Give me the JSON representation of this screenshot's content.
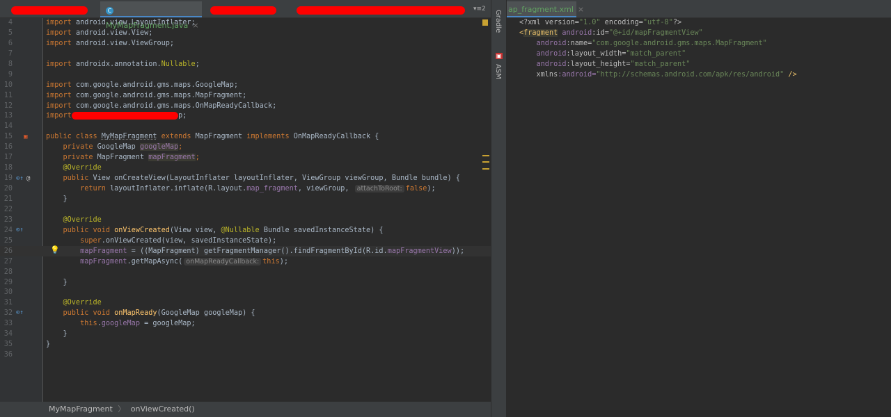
{
  "tabs": {
    "active_label": "MyMapFragment.java",
    "xml_label": "ap_fragment.xml",
    "more": "▾≡2"
  },
  "side": {
    "gradle": "Gradle",
    "asm": "ASM"
  },
  "breadcrumb": {
    "class": "MyMapFragment",
    "method": "onViewCreated()",
    "sep": "〉"
  },
  "java_lines": [
    {
      "n": "4",
      "t": [
        [
          "import",
          "kw"
        ],
        [
          " android.view.LayoutInflater;",
          ""
        ]
      ]
    },
    {
      "n": "5",
      "t": [
        [
          "import",
          "kw"
        ],
        [
          " android.view.View;",
          ""
        ]
      ]
    },
    {
      "n": "6",
      "t": [
        [
          "import",
          "kw"
        ],
        [
          " android.view.ViewGroup;",
          ""
        ]
      ]
    },
    {
      "n": "7",
      "t": []
    },
    {
      "n": "8",
      "t": [
        [
          "import",
          "kw"
        ],
        [
          " androidx.annotation.",
          ""
        ],
        [
          "Nullable",
          "ann"
        ],
        [
          ";",
          ""
        ]
      ]
    },
    {
      "n": "9",
      "t": []
    },
    {
      "n": "10",
      "t": [
        [
          "import",
          "kw"
        ],
        [
          " com.google.android.gms.maps.GoogleMap;",
          ""
        ]
      ]
    },
    {
      "n": "11",
      "t": [
        [
          "import",
          "kw"
        ],
        [
          " com.google.android.gms.maps.MapFragment;",
          ""
        ]
      ]
    },
    {
      "n": "12",
      "t": [
        [
          "import",
          "kw"
        ],
        [
          " com.google.android.gms.maps.OnMapReadyCallback;",
          ""
        ]
      ]
    },
    {
      "n": "13",
      "t": [
        [
          "import",
          "kw"
        ],
        [
          "                         ",
          "redact"
        ],
        [
          "p;",
          ""
        ]
      ]
    },
    {
      "n": "14",
      "t": []
    },
    {
      "n": "15",
      "t": [
        [
          "public class ",
          "kw"
        ],
        [
          "MyMapFragment",
          "cls"
        ],
        [
          " extends ",
          "kw"
        ],
        [
          "MapFragment",
          ""
        ],
        [
          " implements ",
          "kw"
        ],
        [
          "OnMapReadyCallback {",
          ""
        ]
      ]
    },
    {
      "n": "16",
      "t": [
        [
          "    private ",
          "kw"
        ],
        [
          "GoogleMap ",
          ""
        ],
        [
          "googleMap",
          "fldh"
        ],
        [
          ";",
          "kw"
        ]
      ]
    },
    {
      "n": "17",
      "t": [
        [
          "    private ",
          "kw"
        ],
        [
          "MapFragment ",
          ""
        ],
        [
          "mapFragment",
          "fldh"
        ],
        [
          ";",
          "kw"
        ]
      ]
    },
    {
      "n": "18",
      "t": [
        [
          "    @Override",
          "ann"
        ]
      ]
    },
    {
      "n": "19",
      "t": [
        [
          "    public ",
          "kw"
        ],
        [
          "View ",
          ""
        ],
        [
          "onCreateView",
          ""
        ],
        [
          "(LayoutInflater layoutInflater, ViewGroup viewGroup, Bundle bundle) {",
          ""
        ]
      ]
    },
    {
      "n": "20",
      "t": [
        [
          "        return ",
          "kw"
        ],
        [
          "layoutInflater.inflate(R.layout.",
          ""
        ],
        [
          "map_fragment",
          "fld"
        ],
        [
          ", viewGroup, ",
          ""
        ],
        [
          "attachToRoot:",
          "hint"
        ],
        [
          "false",
          "kw"
        ],
        [
          ");",
          ""
        ]
      ]
    },
    {
      "n": "21",
      "t": [
        [
          "    }",
          ""
        ]
      ]
    },
    {
      "n": "22",
      "t": []
    },
    {
      "n": "23",
      "t": [
        [
          "    @Override",
          "ann"
        ]
      ]
    },
    {
      "n": "24",
      "t": [
        [
          "    public void ",
          "kw"
        ],
        [
          "onViewCreated",
          "mth"
        ],
        [
          "(View view, ",
          ""
        ],
        [
          "@Nullable",
          "ann"
        ],
        [
          " Bundle savedInstanceState) {",
          ""
        ]
      ]
    },
    {
      "n": "25",
      "t": [
        [
          "        super",
          "kw"
        ],
        [
          ".onViewCreated(view, savedInstanceState);",
          ""
        ]
      ]
    },
    {
      "n": "26",
      "t": [
        [
          "        mapFragment",
          "fld"
        ],
        [
          " = ((MapFragment) getFragmentManager().findFragmentById(R.id.",
          ""
        ],
        [
          "mapFragmentView",
          "fld"
        ],
        [
          "));",
          ""
        ]
      ]
    },
    {
      "n": "27",
      "t": [
        [
          "        mapFragment",
          "fld"
        ],
        [
          ".getMapAsync(",
          ""
        ],
        [
          "onMapReadyCallback:",
          "hint"
        ],
        [
          "this",
          "kw"
        ],
        [
          ");",
          ""
        ]
      ]
    },
    {
      "n": "28",
      "t": []
    },
    {
      "n": "29",
      "t": [
        [
          "    }",
          ""
        ]
      ]
    },
    {
      "n": "30",
      "t": []
    },
    {
      "n": "31",
      "t": [
        [
          "    @Override",
          "ann"
        ]
      ]
    },
    {
      "n": "32",
      "t": [
        [
          "    public void ",
          "kw"
        ],
        [
          "onMapReady",
          "mth"
        ],
        [
          "(GoogleMap googleMap) {",
          ""
        ]
      ]
    },
    {
      "n": "33",
      "t": [
        [
          "        this",
          "kw"
        ],
        [
          ".",
          ""
        ],
        [
          "googleMap",
          "fld"
        ],
        [
          " = googleMap;",
          ""
        ]
      ]
    },
    {
      "n": "34",
      "t": [
        [
          "    }",
          ""
        ]
      ]
    },
    {
      "n": "35",
      "t": [
        [
          "}",
          ""
        ]
      ]
    },
    {
      "n": "36",
      "t": []
    }
  ],
  "xml_lines": [
    {
      "t": [
        [
          "<?xml version=",
          "xtxt"
        ],
        [
          "\"1.0\"",
          "str"
        ],
        [
          " encoding=",
          "xtxt"
        ],
        [
          "\"utf-8\"",
          "str"
        ],
        [
          "?>",
          "xtxt"
        ]
      ]
    },
    {
      "t": [
        [
          "<",
          "tag"
        ],
        [
          "fragment",
          "tagh"
        ],
        [
          " android",
          "attr"
        ],
        [
          ":id=",
          "xtxt"
        ],
        [
          "\"@+id/mapFragmentView\"",
          "str"
        ]
      ]
    },
    {
      "t": [
        [
          "    android",
          "attr"
        ],
        [
          ":name=",
          "xtxt"
        ],
        [
          "\"com.google.android.gms.maps.MapFragment\"",
          "str"
        ]
      ]
    },
    {
      "t": [
        [
          "    android",
          "attr"
        ],
        [
          ":layout_width=",
          "xtxt"
        ],
        [
          "\"match_parent\"",
          "str"
        ]
      ]
    },
    {
      "t": [
        [
          "    android",
          "attr"
        ],
        [
          ":layout_height=",
          "xtxt"
        ],
        [
          "\"match_parent\"",
          "str"
        ]
      ]
    },
    {
      "t": [
        [
          "    xmlns",
          "xtxt"
        ],
        [
          ":android=",
          "attr"
        ],
        [
          "\"http://schemas.android.com/apk/res/android\"",
          "str"
        ],
        [
          " />",
          "tag"
        ]
      ]
    }
  ],
  "colors": {
    "bg": "#2b2b2b",
    "keyword": "#cc7832",
    "string": "#6a8759",
    "annotation": "#bbb529",
    "method": "#ffc66d",
    "field": "#9876aa"
  }
}
